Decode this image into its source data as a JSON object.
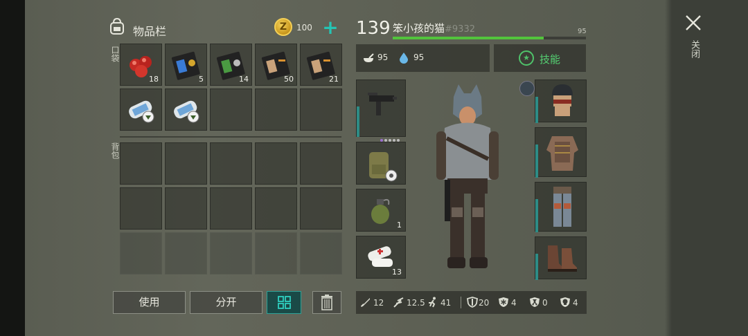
{
  "inventory": {
    "title": "物品栏",
    "coins": "100",
    "pocket_label": "口袋",
    "backpack_label": "背包",
    "pocket_items": [
      {
        "icon": "apples-icon",
        "qty": "18"
      },
      {
        "icon": "blue-badge-case-icon",
        "qty": "5"
      },
      {
        "icon": "green-badge-case-icon",
        "qty": "14"
      },
      {
        "icon": "tan-case-icon",
        "qty": "50"
      },
      {
        "icon": "tan-case-icon",
        "qty": "21"
      },
      {
        "icon": "map-scroll-icon",
        "qty": ""
      },
      {
        "icon": "map-scroll-icon",
        "qty": ""
      }
    ]
  },
  "buttons": {
    "use": "使用",
    "split": "分开"
  },
  "player": {
    "level": "139",
    "name": "笨小孩的猫",
    "tag": "#9332",
    "xp_max": "95",
    "xp_fraction": 0.78,
    "hunger": "95",
    "thirst": "95",
    "skills_label": "技能"
  },
  "equipment": {
    "grenade_qty": "1",
    "medkit_qty": "13"
  },
  "bottom_stats": {
    "melee": "12",
    "ranged": "12.5",
    "speed": "41",
    "armor": "20",
    "cold": "4",
    "radiation": "0",
    "toxic": "4"
  },
  "close_label": "关闭",
  "colors": {
    "accent": "#25c4b4",
    "skills_green": "#54d072",
    "xp_green": "#52c43c"
  }
}
